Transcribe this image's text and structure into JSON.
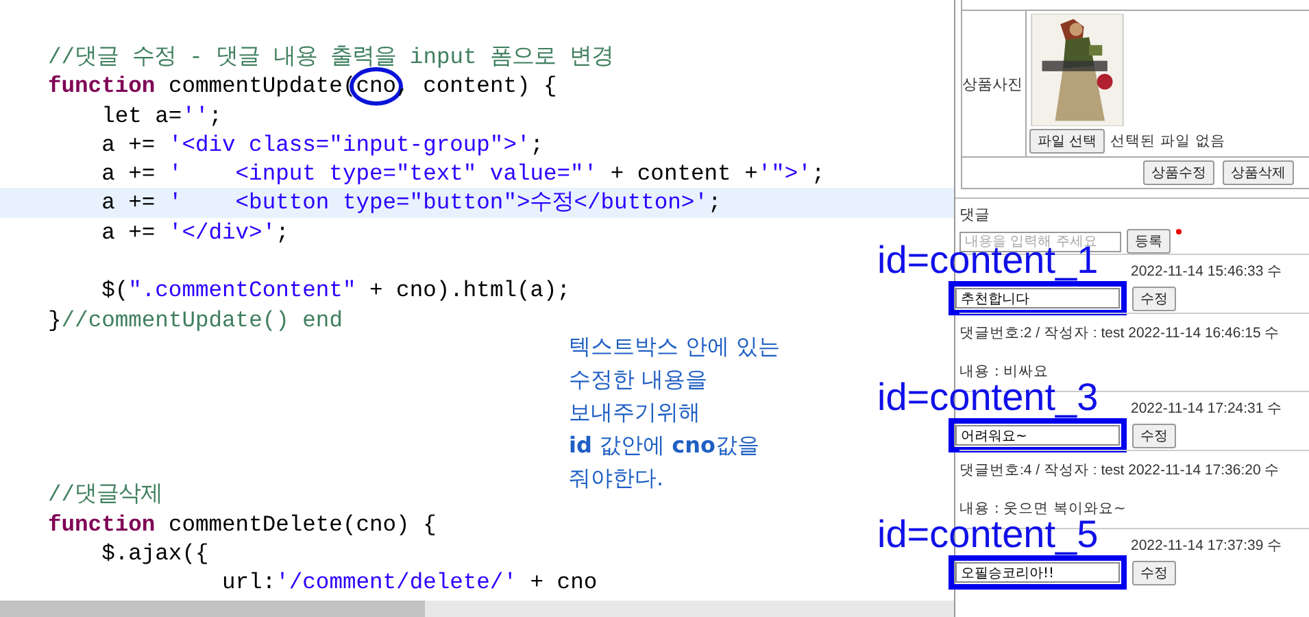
{
  "editor": {
    "lines": [
      {
        "segments": [
          {
            "kind": "comment",
            "text": "//댓글 수정 - 댓글 내용 출력을 input 폼으로 변경"
          }
        ]
      },
      {
        "segments": [
          {
            "kind": "keyword",
            "text": "function"
          },
          {
            "kind": "plain",
            "text": " commentUpdate("
          },
          {
            "kind": "plain",
            "text": "cno",
            "circled": true
          },
          {
            "kind": "plain",
            "text": ", content) {"
          }
        ]
      },
      {
        "segments": [
          {
            "kind": "plain",
            "text": "    let a="
          },
          {
            "kind": "string",
            "text": "''"
          },
          {
            "kind": "plain",
            "text": ";"
          }
        ]
      },
      {
        "segments": [
          {
            "kind": "plain",
            "text": "    a += "
          },
          {
            "kind": "string",
            "text": "'<div class=\"input-group\">'"
          },
          {
            "kind": "plain",
            "text": ";"
          }
        ]
      },
      {
        "segments": [
          {
            "kind": "plain",
            "text": "    a += "
          },
          {
            "kind": "string",
            "text": "'    <input type=\"text\" value=\"'"
          },
          {
            "kind": "plain",
            "text": " + content +"
          },
          {
            "kind": "string",
            "text": "'\">'"
          },
          {
            "kind": "plain",
            "text": ";"
          }
        ]
      },
      {
        "current": true,
        "segments": [
          {
            "kind": "plain",
            "text": "    a += "
          },
          {
            "kind": "string",
            "text": "'    <button type=\"button\">수정</button>'"
          },
          {
            "kind": "plain",
            "text": ";"
          }
        ]
      },
      {
        "segments": [
          {
            "kind": "plain",
            "text": "    a += "
          },
          {
            "kind": "string",
            "text": "'</div>'"
          },
          {
            "kind": "plain",
            "text": ";"
          }
        ]
      },
      {
        "kind": "blank"
      },
      {
        "segments": [
          {
            "kind": "plain",
            "text": "    $("
          },
          {
            "kind": "string",
            "text": "\".commentContent\""
          },
          {
            "kind": "plain",
            "text": " + cno).html(a);"
          }
        ]
      },
      {
        "segments": [
          {
            "kind": "plain",
            "text": "}"
          },
          {
            "kind": "comment",
            "text": "//commentUpdate() end"
          }
        ]
      },
      {
        "kind": "blank"
      },
      {
        "kind": "blank"
      },
      {
        "kind": "blank"
      },
      {
        "kind": "blank"
      },
      {
        "kind": "blank"
      },
      {
        "segments": [
          {
            "kind": "comment",
            "text": "//댓글삭제"
          }
        ]
      },
      {
        "segments": [
          {
            "kind": "keyword",
            "text": "function"
          },
          {
            "kind": "plain",
            "text": " commentDelete(cno) {"
          }
        ]
      },
      {
        "segments": [
          {
            "kind": "plain",
            "text": "    $.ajax({"
          }
        ]
      },
      {
        "segments": [
          {
            "kind": "plain",
            "text": "             url:"
          },
          {
            "kind": "string",
            "text": "'/comment/delete/'"
          },
          {
            "kind": "plain",
            "text": " + cno"
          }
        ]
      }
    ]
  },
  "note": {
    "lines": [
      "텍스트박스 안에 있는",
      "수정한 내용을",
      "보내주기위해",
      "**id** 값안에 **cno**값을",
      "줘야한다."
    ]
  },
  "browser": {
    "product": {
      "photo_label": "상품사진",
      "file_button": "파일 선택",
      "file_status": "선택된 파일 없음",
      "buttons": [
        "상품수정",
        "상품삭제"
      ]
    },
    "comments_title": "댓글",
    "comment_input": {
      "placeholder": "내용을 입력해 주세요"
    },
    "submit_button": "등록",
    "comments": [
      {
        "kind": "editing",
        "header": "2022-11-14 15:46:33 수",
        "value": "추천합니다",
        "button": "수정",
        "annotation": "id=content_1"
      },
      {
        "kind": "text",
        "header": "댓글번호:2 / 작성자 : test 2022-11-14 16:46:15 수",
        "content": "내용 : 비싸요"
      },
      {
        "kind": "editing",
        "header": "2022-11-14 17:24:31 수",
        "value": "어려워요~",
        "button": "수정",
        "annotation": "id=content_3"
      },
      {
        "kind": "text",
        "header": "댓글번호:4 / 작성자 : test 2022-11-14 17:36:20 수",
        "content": "내용 : 웃으면 복이와요~"
      },
      {
        "kind": "editing",
        "header": "2022-11-14 17:37:39 수",
        "value": "오필승코리아!!",
        "button": "수정",
        "annotation": "id=content_5"
      }
    ]
  }
}
